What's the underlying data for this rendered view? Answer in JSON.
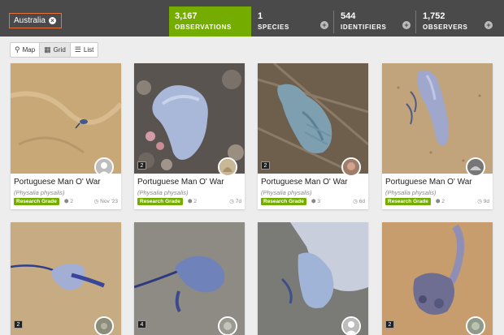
{
  "place_filter": "Australia",
  "stats": {
    "observations": {
      "count": "3,167",
      "label": "OBSERVATIONS"
    },
    "species": {
      "count": "1",
      "label": "SPECIES"
    },
    "identifiers": {
      "count": "544",
      "label": "IDENTIFIERS"
    },
    "observers": {
      "count": "1,752",
      "label": "OBSERVERS"
    }
  },
  "view_toggle": [
    "Map",
    "Grid",
    "List"
  ],
  "active_view": "Grid",
  "cards": [
    {
      "photo_count": "",
      "common_name": "Portuguese Man O' War",
      "sci_name": "(Physalia physalis)",
      "grade": "Research Grade",
      "ids": "2",
      "date": "Nov '23"
    },
    {
      "photo_count": "2",
      "common_name": "Portuguese Man O' War",
      "sci_name": "(Physalia physalis)",
      "grade": "Research Grade",
      "ids": "2",
      "date": "7d"
    },
    {
      "photo_count": "2",
      "common_name": "Portuguese Man O' War",
      "sci_name": "(Physalia physalis)",
      "grade": "Research Grade",
      "ids": "3",
      "date": "6d"
    },
    {
      "photo_count": "",
      "common_name": "Portuguese Man O' War",
      "sci_name": "(Physalia physalis)",
      "grade": "Research Grade",
      "ids": "2",
      "date": "9d"
    },
    {
      "photo_count": "2"
    },
    {
      "photo_count": "4"
    },
    {
      "photo_count": ""
    },
    {
      "photo_count": "2"
    }
  ]
}
